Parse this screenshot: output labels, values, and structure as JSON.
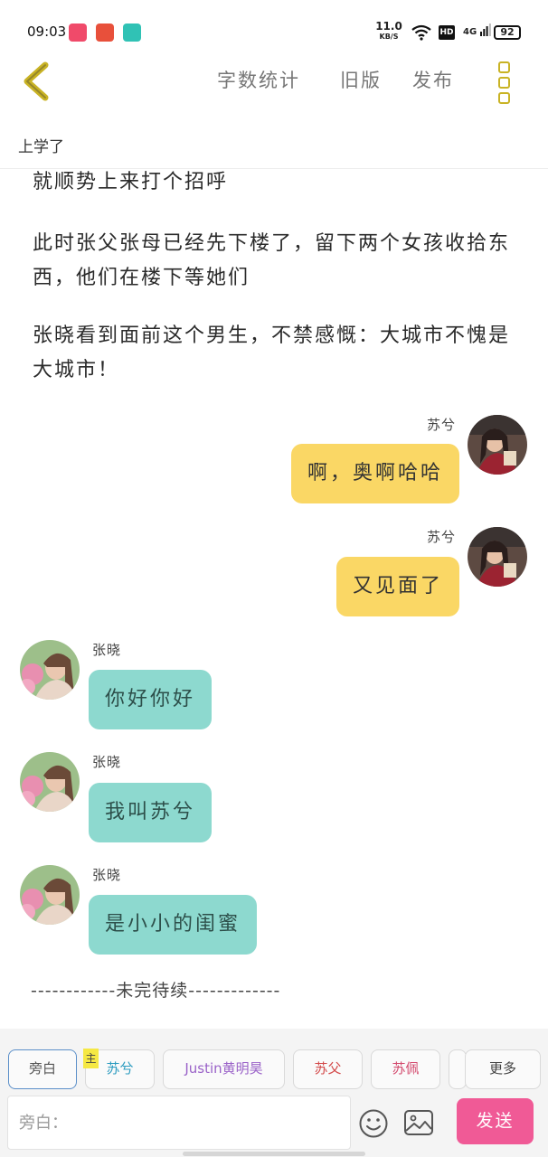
{
  "status_bar": {
    "time": "09:03",
    "net_speed_value": "11.0",
    "net_speed_unit": "KB/S",
    "hd_label": "HD",
    "network_label": "4G",
    "battery": "92"
  },
  "header": {
    "word_count_label": "字数统计",
    "old_version_label": "旧版",
    "publish_label": "发布"
  },
  "chapter": {
    "title": "上学了"
  },
  "story": {
    "paragraphs": [
      "就顺势上来打个招呼",
      "此时张父张母已经先下楼了，留下两个女孩收拾东西，他们在楼下等她们",
      "张晓看到面前这个男生，不禁感慨：大城市不愧是大城市！"
    ],
    "messages": [
      {
        "speaker": "苏兮",
        "text": "啊，奥啊哈哈"
      },
      {
        "speaker": "苏兮",
        "text": "又见面了"
      },
      {
        "speaker": "张晓",
        "text": "你好你好"
      },
      {
        "speaker": "张晓",
        "text": "我叫苏兮"
      },
      {
        "speaker": "张晓",
        "text": "是小小的闺蜜"
      }
    ],
    "end_marker": "------------未完待续-------------"
  },
  "characters": {
    "narrator": "旁白",
    "main_tag": "主",
    "list": [
      "苏兮",
      "Justin黄明昊",
      "苏父",
      "苏佩"
    ],
    "more": "更多"
  },
  "composer": {
    "placeholder": "旁白：",
    "send_label": "发送"
  },
  "colors": {
    "accent_yellow": "#fad765",
    "bubble_teal": "#8dd9cf",
    "send_pink": "#f05a96",
    "back_arrow": "#c9b325"
  }
}
